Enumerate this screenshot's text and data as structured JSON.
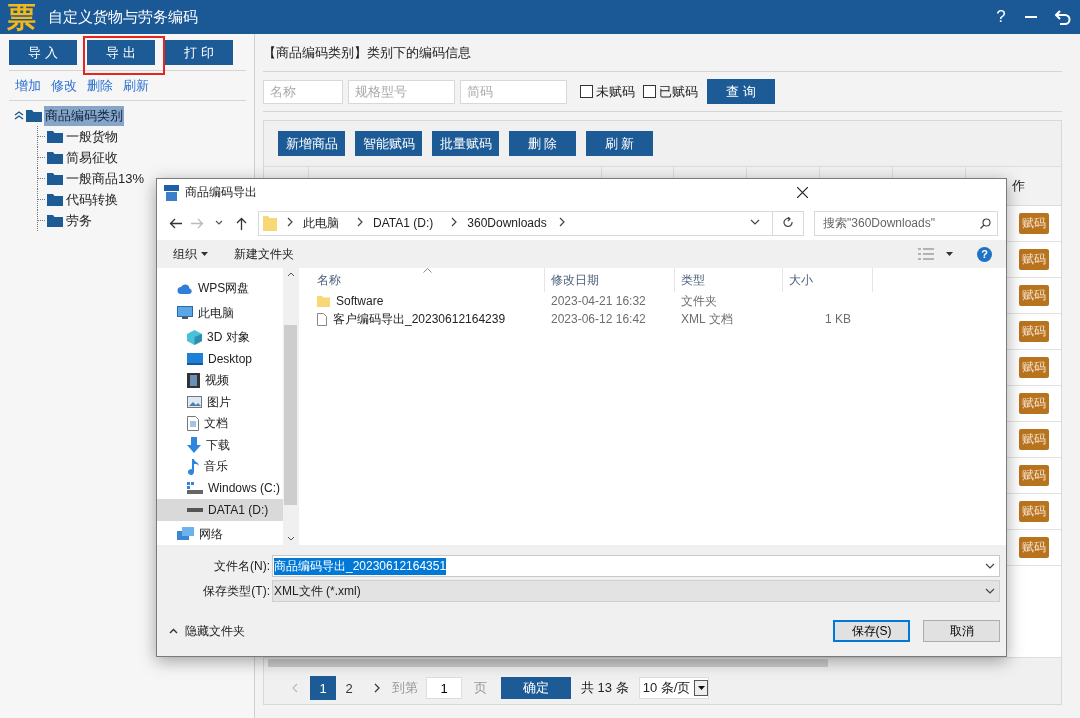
{
  "window": {
    "logo_text": "票",
    "title": "自定义货物与劳务编码",
    "help_label": "?"
  },
  "left_toolbar": {
    "buttons": [
      {
        "label": "导 入",
        "highlighted": false
      },
      {
        "label": "导 出",
        "highlighted": true
      },
      {
        "label": "打 印",
        "highlighted": false
      }
    ]
  },
  "tree_actions": [
    "增加",
    "修改",
    "删除",
    "刷新"
  ],
  "tree": {
    "label": "商品编码类别",
    "selected": true,
    "expanded": true,
    "children": [
      {
        "label": "一般货物",
        "selected": false
      },
      {
        "label": "简易征收",
        "selected": false
      },
      {
        "label": "一般商品13%",
        "selected": false
      },
      {
        "label": "代码转换",
        "selected": false
      },
      {
        "label": "劳务",
        "selected": false
      }
    ]
  },
  "content": {
    "heading": "【商品编码类别】类别下的编码信息",
    "filters": [
      {
        "placeholder": "名称"
      },
      {
        "placeholder": "规格型号"
      },
      {
        "placeholder": "简码"
      }
    ],
    "checkboxes": [
      {
        "label": "未赋码",
        "checked": false
      },
      {
        "label": "已赋码",
        "checked": false
      }
    ],
    "query_button": "查 询",
    "actions": [
      "新增商品",
      "智能赋码",
      "批量赋码",
      "删 除",
      "刷 新"
    ],
    "table": {
      "last_column_header": "作",
      "rows": [
        {
          "action": "赋码"
        },
        {
          "action": "赋码"
        },
        {
          "action": "赋码"
        },
        {
          "action": "赋码"
        },
        {
          "action": "赋码"
        },
        {
          "action": "赋码"
        },
        {
          "action": "赋码"
        },
        {
          "action": "赋码"
        },
        {
          "action": "赋码"
        },
        {
          "action": "赋码"
        }
      ]
    },
    "pagination": {
      "pages": [
        {
          "label": "1",
          "selected": true
        },
        {
          "label": "2",
          "selected": false
        }
      ],
      "goto_label": "到第",
      "goto_value": "1",
      "page_unit": "页",
      "confirm": "确定",
      "total": "共 13 条",
      "page_size": "10 条/页"
    }
  },
  "dialog": {
    "title": "商品编码导出",
    "breadcrumbs": [
      "此电脑",
      "DATA1 (D:)",
      "360Downloads"
    ],
    "search": {
      "placeholder": "搜索\"360Downloads\""
    },
    "toolbar": {
      "organize": "组织",
      "new_folder": "新建文件夹",
      "help_label": "?"
    },
    "nav": [
      {
        "label": "WPS网盘",
        "kind": "cloud",
        "selected": false
      },
      {
        "label": "此电脑",
        "kind": "pc",
        "selected": false,
        "children": [
          {
            "label": "3D 对象",
            "kind": "cube",
            "selected": false
          },
          {
            "label": "Desktop",
            "kind": "desktop",
            "selected": false
          },
          {
            "label": "视频",
            "kind": "video",
            "selected": false
          },
          {
            "label": "图片",
            "kind": "picture",
            "selected": false
          },
          {
            "label": "文档",
            "kind": "document",
            "selected": false
          },
          {
            "label": "下载",
            "kind": "download",
            "selected": false
          },
          {
            "label": "音乐",
            "kind": "music",
            "selected": false
          },
          {
            "label": "Windows (C:)",
            "kind": "system-drive",
            "selected": false
          },
          {
            "label": "DATA1 (D:)",
            "kind": "drive",
            "selected": true
          }
        ]
      },
      {
        "label": "网络",
        "kind": "network",
        "selected": false
      }
    ],
    "columns": [
      "名称",
      "修改日期",
      "类型",
      "大小"
    ],
    "files": [
      {
        "kind": "folder",
        "name": "Software",
        "modified": "2023-04-21 16:32",
        "type": "文件夹"
      },
      {
        "kind": "file",
        "name": "客户编码导出_20230612164239",
        "modified": "2023-06-12 16:42",
        "type": "XML 文档",
        "size": "1 KB"
      }
    ],
    "filename_label": "文件名(N):",
    "filename": "商品编码导出_20230612164351",
    "filetype_label": "保存类型(T):",
    "filetype": "XML文件 (*.xml)",
    "hide_folders": "隐藏文件夹",
    "save_button": "保存(S)",
    "cancel_button": "取消"
  }
}
